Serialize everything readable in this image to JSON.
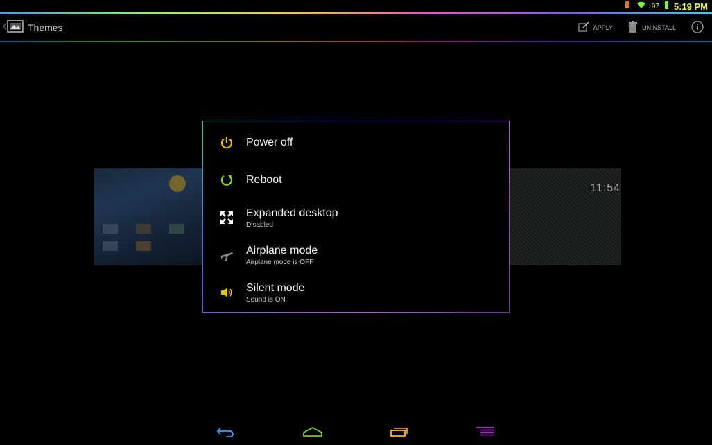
{
  "status_bar": {
    "battery_level": "97",
    "time": "5:19 PM"
  },
  "action_bar": {
    "title": "Themes",
    "apply_label": "APPLY",
    "uninstall_label": "UNINSTALL"
  },
  "preview_right": {
    "clock": "11:54"
  },
  "power_menu": {
    "items": [
      {
        "label": "Power off",
        "sublabel": ""
      },
      {
        "label": "Reboot",
        "sublabel": ""
      },
      {
        "label": "Expanded desktop",
        "sublabel": "Disabled"
      },
      {
        "label": "Airplane mode",
        "sublabel": "Airplane mode is OFF"
      },
      {
        "label": "Silent mode",
        "sublabel": "Sound is ON"
      }
    ]
  },
  "colors": {
    "power_icon": "#e8c400",
    "reboot_icon": "#8bd600",
    "status_text": "#e8ff3a",
    "nav_back": "#3aa0ff",
    "nav_home": "#7cd000",
    "nav_recent": "#ffb400",
    "nav_menu": "#d43cff"
  }
}
